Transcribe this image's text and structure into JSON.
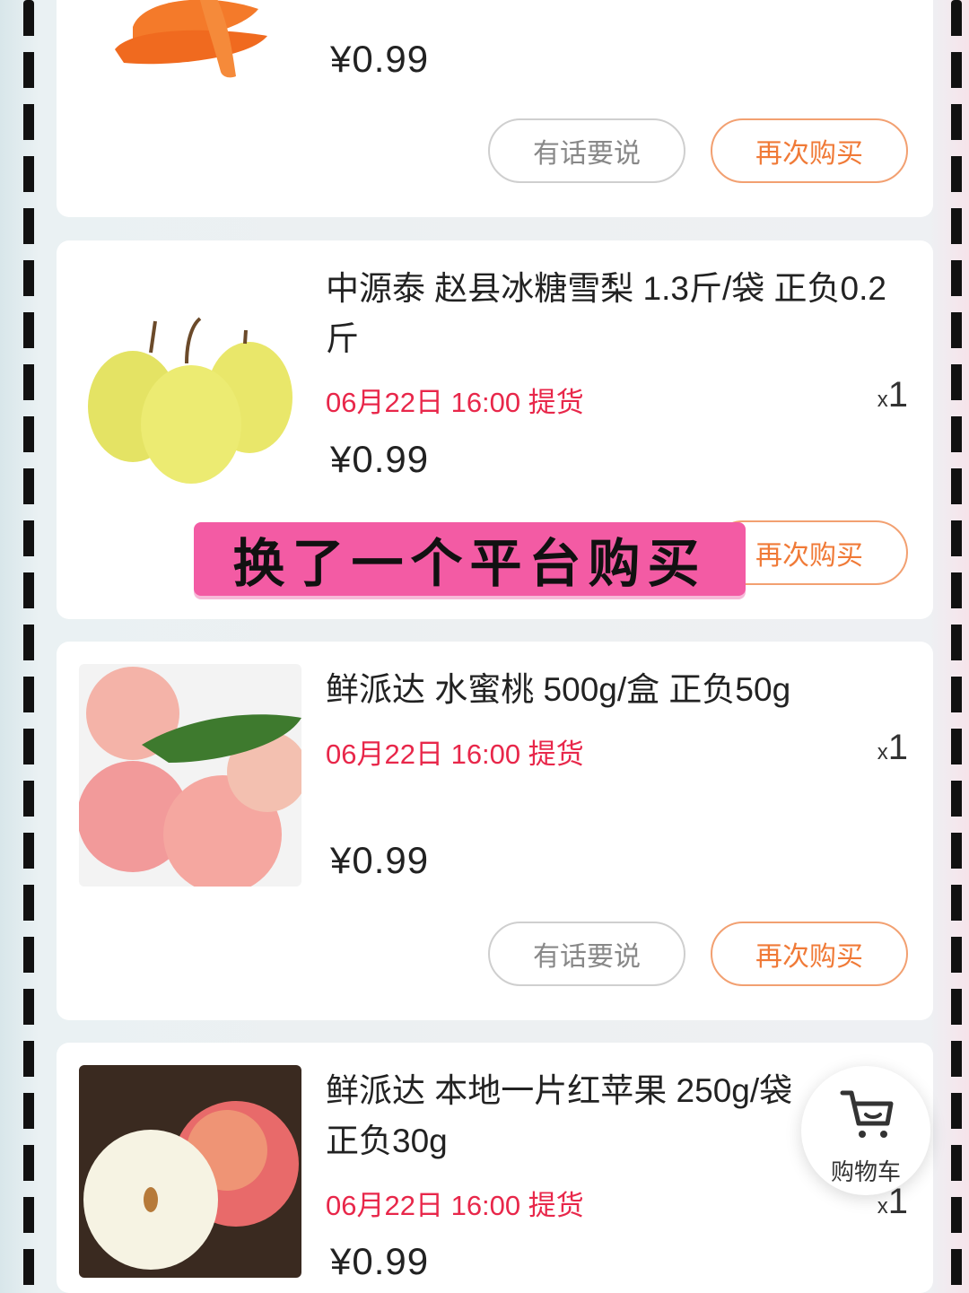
{
  "cards": [
    {
      "title": "",
      "price": "¥0.99",
      "buttons": {
        "feedback": "有话要说",
        "rebuy": "再次购买"
      }
    },
    {
      "title": "中源泰 赵县冰糖雪梨 1.3斤/袋 正负0.2斤",
      "pickup": "06月22日 16:00 提货",
      "qty_prefix": "x",
      "qty": "1",
      "price": "¥0.99",
      "buttons": {
        "rebuy": "再次购买"
      }
    },
    {
      "title": "鲜派达 水蜜桃 500g/盒 正负50g",
      "pickup": "06月22日 16:00 提货",
      "qty_prefix": "x",
      "qty": "1",
      "price": "¥0.99",
      "buttons": {
        "feedback": "有话要说",
        "rebuy": "再次购买"
      }
    },
    {
      "title": "鲜派达 本地一片红苹果 250g/袋 正负30g",
      "pickup": "06月22日 16:00 提货",
      "qty_prefix": "x",
      "qty": "1",
      "price": "¥0.99"
    }
  ],
  "overlay_banner": "换了一个平台购买",
  "cart_fab": {
    "label": "购物车",
    "icon": "shopping-cart-icon"
  },
  "colors": {
    "pickup_red": "#e8274a",
    "rebuy_orange": "#f07a37",
    "banner_pink": "#f35ba4"
  }
}
